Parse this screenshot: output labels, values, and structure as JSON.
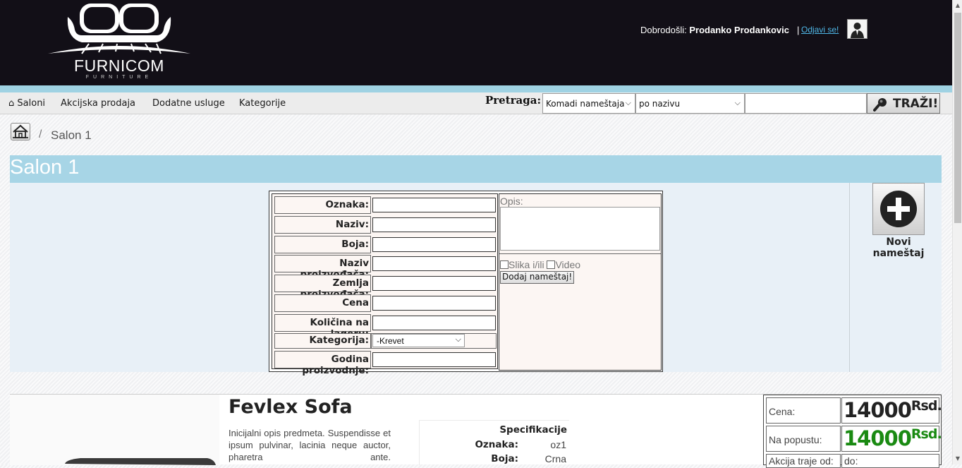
{
  "header": {
    "logo_text": "FURNICOM",
    "logo_sub": "FURNITURE",
    "welcome_label": "Dobrodošli:",
    "user_name": "Prodanko Prodankovic",
    "separator": "|",
    "logout_label": "Odjavi se!"
  },
  "nav": {
    "items": [
      "Saloni",
      "Akcijska prodaja",
      "Dodatne usluge",
      "Kategorije"
    ],
    "home_glyph": "⌂"
  },
  "search": {
    "label": "Pretraga:",
    "type_value": "Komadi nameštaja",
    "by_value": "po nazivu",
    "button_label": "TRAŽI!"
  },
  "breadcrumb": {
    "separator": "/",
    "current": "Salon 1"
  },
  "page_title": "Salon 1",
  "form": {
    "fields": [
      "Oznaka:",
      "Naziv:",
      "Boja:",
      "Naziv proizvođača:",
      "Zemlja proizvođača:",
      "Cena",
      "Količina na lageru:",
      "Kategorija:",
      "Godina proizvodnje:"
    ],
    "category_value": "-Krevet",
    "opis_label": "Opis:",
    "image_checkbox_label": "Slika i/ili",
    "video_checkbox_label": "Video",
    "submit_label": "Dodaj nameštaj!"
  },
  "new_furniture": {
    "label": "Novi nameštaj"
  },
  "product": {
    "name": "Fevlex Sofa",
    "description": "Inicijalni opis predmeta. Suspendisse et ipsum pulvinar, lacinia neque auctor, pharetra ante.",
    "specs_title": "Specifikacije",
    "specs": [
      {
        "key": "Oznaka:",
        "value": "oz1"
      },
      {
        "key": "Boja:",
        "value": "Crna"
      }
    ],
    "price_label": "Cena:",
    "price_value": "14000",
    "currency": "Rsd.",
    "discount_label": "Na popustu:",
    "discount_value": "14000",
    "action_from_label": "Akcija traje od:",
    "action_to_label": "do:",
    "colors": {
      "price": "#222222",
      "discount": "#1a8a12"
    }
  }
}
